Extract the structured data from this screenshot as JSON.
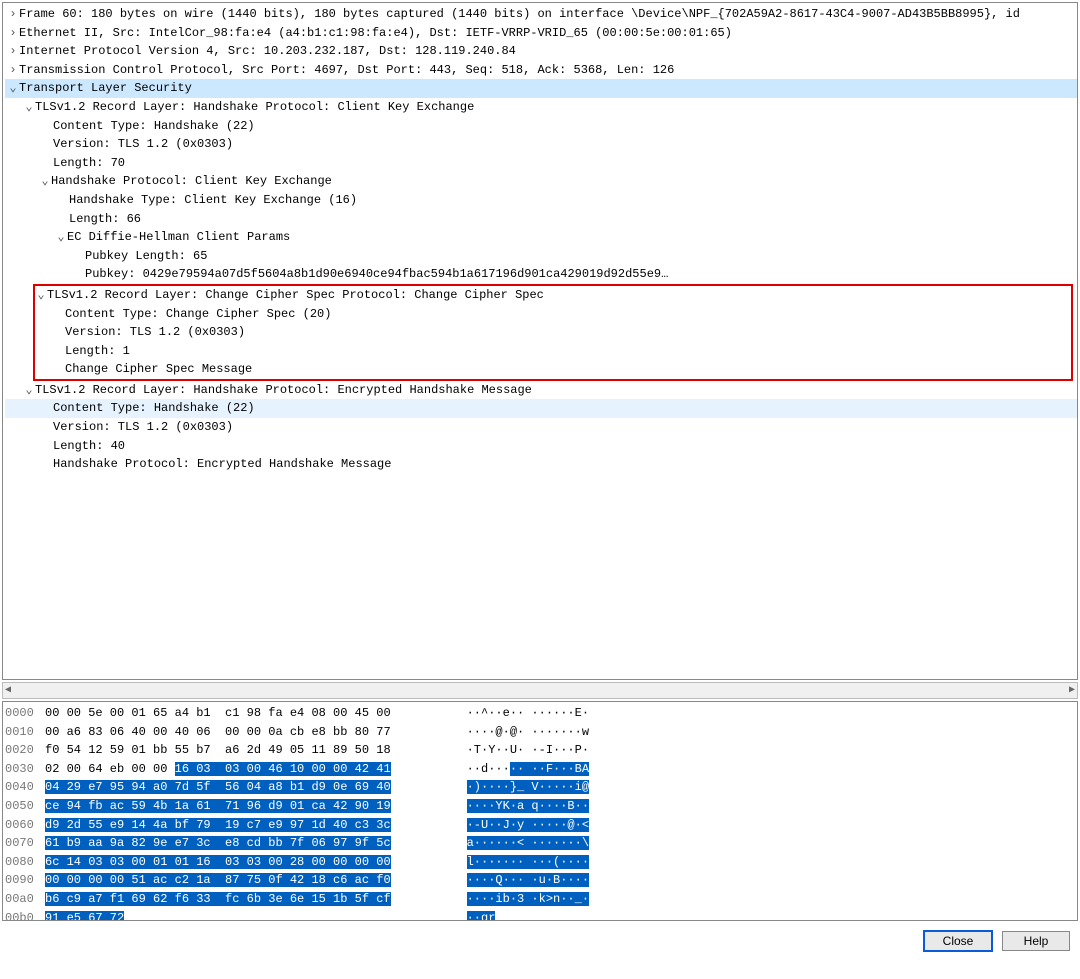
{
  "tree": {
    "frame": "Frame 60: 180 bytes on wire (1440 bits), 180 bytes captured (1440 bits) on interface \\Device\\NPF_{702A59A2-8617-43C4-9007-AD43B5BB8995}, id",
    "eth": "Ethernet II, Src: IntelCor_98:fa:e4 (a4:b1:c1:98:fa:e4), Dst: IETF-VRRP-VRID_65 (00:00:5e:00:01:65)",
    "ip": "Internet Protocol Version 4, Src: 10.203.232.187, Dst: 128.119.240.84",
    "tcp": "Transmission Control Protocol, Src Port: 4697, Dst Port: 443, Seq: 518, Ack: 5368, Len: 126",
    "tls": "Transport Layer Security",
    "r1": "TLSv1.2 Record Layer: Handshake Protocol: Client Key Exchange",
    "r1_ct": "Content Type: Handshake (22)",
    "r1_ver": "Version: TLS 1.2 (0x0303)",
    "r1_len": "Length: 70",
    "r1_hp": "Handshake Protocol: Client Key Exchange",
    "r1_ht": "Handshake Type: Client Key Exchange (16)",
    "r1_hlen": "Length: 66",
    "r1_ec": "EC Diffie-Hellman Client Params",
    "r1_pklen": "Pubkey Length: 65",
    "r1_pk": "Pubkey: 0429e79594a07d5f5604a8b1d90e6940ce94fbac594b1a617196d901ca429019d92d55e9…",
    "r2": "TLSv1.2 Record Layer: Change Cipher Spec Protocol: Change Cipher Spec",
    "r2_ct": "Content Type: Change Cipher Spec (20)",
    "r2_ver": "Version: TLS 1.2 (0x0303)",
    "r2_len": "Length: 1",
    "r2_msg": "Change Cipher Spec Message",
    "r3": "TLSv1.2 Record Layer: Handshake Protocol: Encrypted Handshake Message",
    "r3_ct": "Content Type: Handshake (22)",
    "r3_ver": "Version: TLS 1.2 (0x0303)",
    "r3_len": "Length: 40",
    "r3_hp": "Handshake Protocol: Encrypted Handshake Message"
  },
  "hex": {
    "offsets": [
      "0000",
      "0010",
      "0020",
      "0030",
      "0040",
      "0050",
      "0060",
      "0070",
      "0080",
      "0090",
      "00a0",
      "00b0"
    ],
    "lines": [
      {
        "pre": "00 00 5e 00 01 65 a4 b1  c1 98 fa e4 08 00 45 00",
        "sel": "",
        "apre": "··^··e·· ······E·",
        "asel": ""
      },
      {
        "pre": "00 a6 83 06 40 00 40 06  00 00 0a cb e8 bb 80 77",
        "sel": "",
        "apre": "····@·@· ·······w",
        "asel": ""
      },
      {
        "pre": "f0 54 12 59 01 bb 55 b7  a6 2d 49 05 11 89 50 18",
        "sel": "",
        "apre": "·T·Y··U· ·-I···P·",
        "asel": ""
      },
      {
        "pre": "02 00 64 eb 00 00 ",
        "sel": "16 03  03 00 46 10 00 00 42 41",
        "apre": "··d···",
        "asel": "·· ··F···BA"
      },
      {
        "pre": "",
        "sel": "04 29 e7 95 94 a0 7d 5f  56 04 a8 b1 d9 0e 69 40",
        "apre": "",
        "asel": "·)····}_ V·····i@"
      },
      {
        "pre": "",
        "sel": "ce 94 fb ac 59 4b 1a 61  71 96 d9 01 ca 42 90 19",
        "apre": "",
        "asel": "····YK·a q····B··"
      },
      {
        "pre": "",
        "sel": "d9 2d 55 e9 14 4a bf 79  19 c7 e9 97 1d 40 c3 3c",
        "apre": "",
        "asel": "·-U··J·y ·····@·<"
      },
      {
        "pre": "",
        "sel": "61 b9 aa 9a 82 9e e7 3c  e8 cd bb 7f 06 97 9f 5c",
        "apre": "",
        "asel": "a······< ·······\\"
      },
      {
        "pre": "",
        "sel": "6c 14 03 03 00 01 01 16  03 03 00 28 00 00 00 00",
        "apre": "",
        "asel": "l······· ···(····"
      },
      {
        "pre": "",
        "sel": "00 00 00 00 51 ac c2 1a  87 75 0f 42 18 c6 ac f0",
        "apre": "",
        "asel": "····Q··· ·u·B····"
      },
      {
        "pre": "",
        "sel": "b6 c9 a7 f1 69 62 f6 33  fc 6b 3e 6e 15 1b 5f cf",
        "apre": "",
        "asel": "····ib·3 ·k>n··_·"
      },
      {
        "pre": "",
        "sel": "91 e5 67 72",
        "apre": "",
        "asel": "··gr"
      }
    ]
  },
  "buttons": {
    "close": "Close",
    "help": "Help"
  }
}
